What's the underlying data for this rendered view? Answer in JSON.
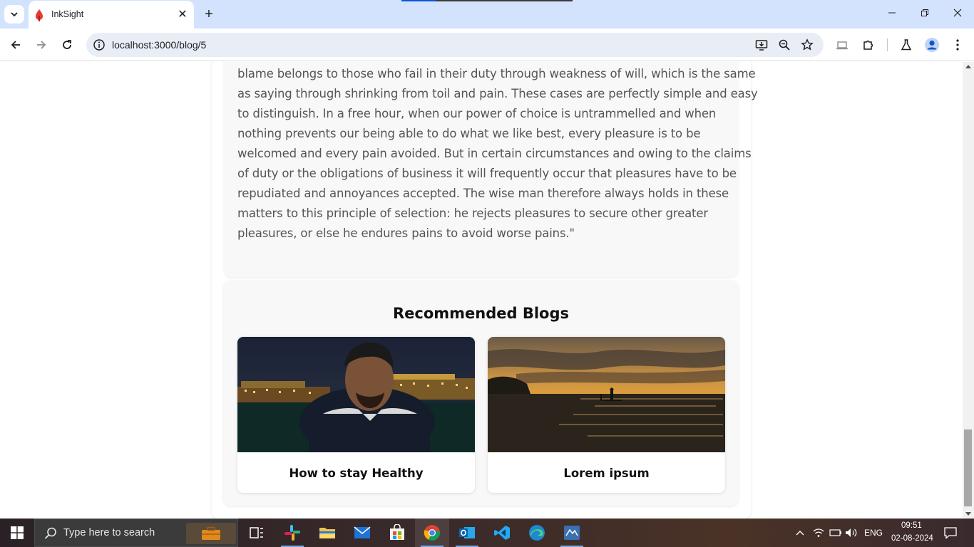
{
  "browser": {
    "tab": {
      "title": "InkSight",
      "close_label": "✕"
    },
    "new_tab_label": "+",
    "url": "localhost:3000/blog/5",
    "window_controls": {
      "minimize": "—",
      "restore": "❐",
      "close": "✕"
    }
  },
  "article": {
    "lines": [
      "blame belongs to those who fail in their duty through weakness of will, which is the same",
      "as saying through shrinking from toil and pain. These cases are perfectly simple and easy",
      "to distinguish. In a free hour, when our power of choice is untrammelled and when",
      "nothing prevents our being able to do what we like best, every pleasure is to be",
      "welcomed and every pain avoided. But in certain circumstances and owing to the claims",
      "of duty or the obligations of business it will frequently occur that pleasures have to be",
      "repudiated and annoyances accepted. The wise man therefore always holds in these",
      "matters to this principle of selection: he rejects pleasures to secure other greater",
      "pleasures, or else he endures pains to avoid worse pains.\""
    ]
  },
  "recommended": {
    "title": "Recommended Blogs",
    "blogs": [
      {
        "title": "How to stay Healthy"
      },
      {
        "title": "Lorem ipsum"
      }
    ]
  },
  "taskbar": {
    "search_placeholder": "Type here to search",
    "language": "ENG",
    "time": "09:51",
    "date": "02-08-2024"
  },
  "colors": {
    "tabstrip": "#d3e3fd",
    "omnibox": "#e9eef6",
    "card_bg": "#f8f8f8",
    "body_text": "#555555",
    "heading_text": "#111111"
  }
}
